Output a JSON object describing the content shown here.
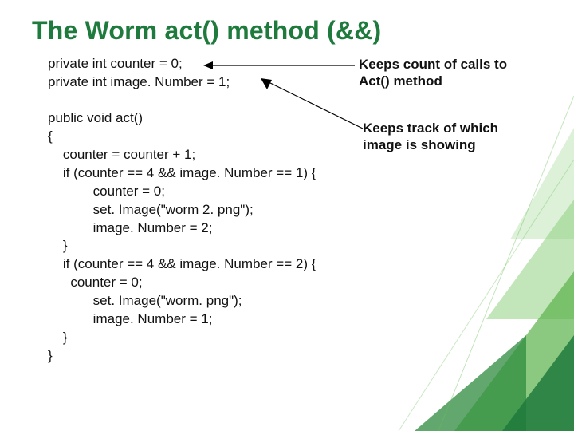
{
  "title": "The Worm act() method (&&)",
  "decl": "private int counter = 0;\nprivate int image. Number = 1;",
  "annot1": "Keeps count of calls to Act() method",
  "annot2": "Keeps track of which image is showing",
  "method_sig": "public void act()",
  "brace_open": "{",
  "body": "    counter = counter + 1;\n    if (counter == 4 && image. Number == 1) {\n            counter = 0;\n            set. Image(\"worm 2. png\");\n            image. Number = 2;\n    }\n    if (counter == 4 && image. Number == 2) {\n      counter = 0;\n            set. Image(\"worm. png\");\n            image. Number = 1;\n    }\n}"
}
